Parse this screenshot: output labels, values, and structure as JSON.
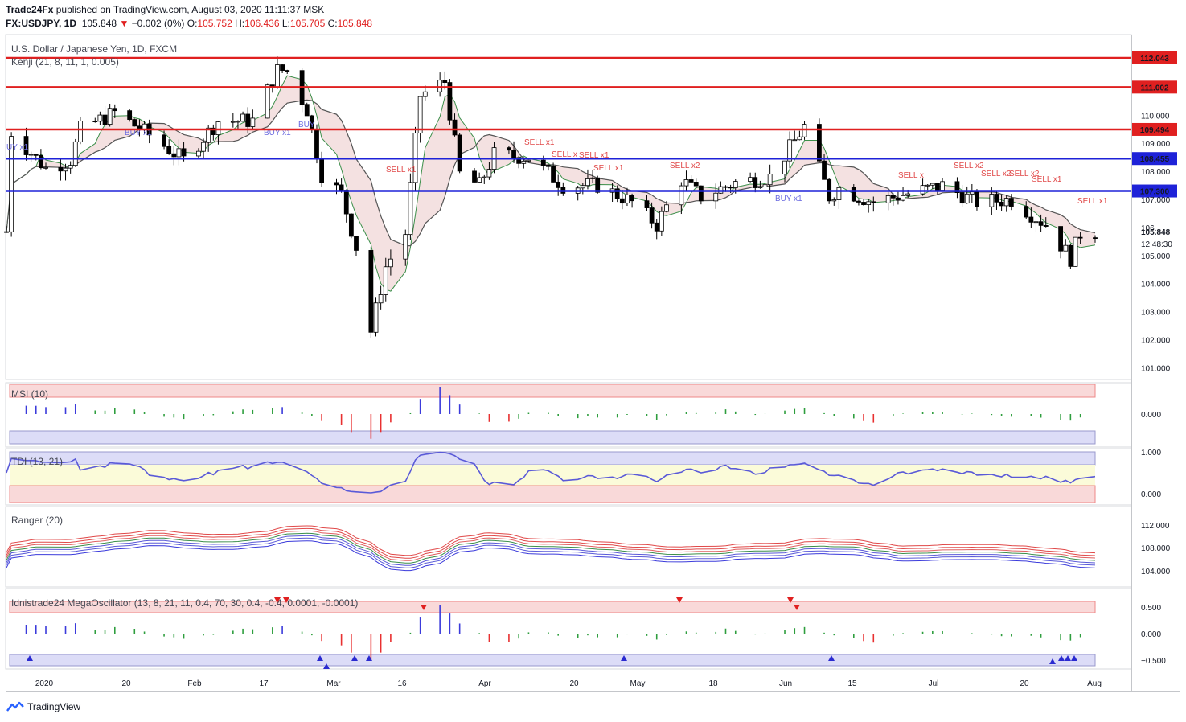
{
  "header": {
    "publisher": "Trade24Fx",
    "published_text": "published on TradingView.com, August 03, 2020 11:11:37 MSK",
    "symbol": "FX:USDJPY, 1D",
    "last": "105.848",
    "change_arrow": "▼",
    "change": "−0.002 (0%)",
    "o_label": "O:",
    "o_value": "105.752",
    "h_label": "H:",
    "h_value": "106.436",
    "l_label": "L:",
    "l_value": "105.705",
    "c_label": "C:",
    "c_value": "105.848"
  },
  "main_pane": {
    "title": "U.S. Dollar / Japanese Yen, 1D, FXCM",
    "indicator": "Kenji (21, 8, 11, 1, 0.005)",
    "price_ticks": [
      "110.000",
      "109.000",
      "108.000",
      "107.000",
      "105.000",
      "104.000",
      "103.000",
      "102.000",
      "101.000"
    ],
    "partial_tick": "106.",
    "horizontal_levels": [
      {
        "price": 112.043,
        "label": "112.043",
        "color": "#e02020"
      },
      {
        "price": 111.002,
        "label": "111.002",
        "color": "#e02020"
      },
      {
        "price": 109.494,
        "label": "109.494",
        "color": "#e02020"
      },
      {
        "price": 108.455,
        "label": "108.455",
        "color": "#1e22d8"
      },
      {
        "price": 107.3,
        "label": "107.300",
        "color": "#1e22d8"
      }
    ],
    "last_price_label": "105.848",
    "countdown": "12:48:30",
    "signals": [
      {
        "text": "UY x1",
        "type": "buy"
      },
      {
        "text": "BUY x1",
        "type": "buy"
      },
      {
        "text": "BUY x1",
        "type": "buy"
      },
      {
        "text": "BUY",
        "type": "buy"
      },
      {
        "text": "SELL x1",
        "type": "sell"
      },
      {
        "text": "SELL x1",
        "type": "sell"
      },
      {
        "text": "SELL x",
        "type": "sell"
      },
      {
        "text": "SELL x1",
        "type": "sell"
      },
      {
        "text": "SELL x1",
        "type": "sell"
      },
      {
        "text": "SELL x2",
        "type": "sell"
      },
      {
        "text": "BUY x1",
        "type": "buy"
      },
      {
        "text": "SELL x",
        "type": "sell"
      },
      {
        "text": "SELL x2",
        "type": "sell"
      },
      {
        "text": "SELL x2",
        "type": "sell"
      },
      {
        "text": "SELL x2",
        "type": "sell"
      },
      {
        "text": "SELL x1",
        "type": "sell"
      },
      {
        "text": "SELL x1",
        "type": "sell"
      }
    ]
  },
  "panes": {
    "msi": {
      "title": "MSI (10)",
      "ticks": [
        "0.000"
      ]
    },
    "tdi": {
      "title": "TDI (13, 21)",
      "ticks": [
        "1.000",
        "0.000"
      ]
    },
    "ranger": {
      "title": "Ranger (20)",
      "ticks": [
        "112.000",
        "108.000",
        "104.000"
      ]
    },
    "osc": {
      "title": "Idnistrade24 MegaOscillator (13, 8, 21, 11, 0.4, 70, 30, 0.4, -0.4, 0.0001, -0.0001)",
      "ticks": [
        "0.500",
        "0.000",
        "−0.500"
      ]
    }
  },
  "x_axis": {
    "labels": [
      "2020",
      "20",
      "Feb",
      "17",
      "Mar",
      "16",
      "Apr",
      "20",
      "May",
      "18",
      "Jun",
      "15",
      "Jul",
      "20",
      "Aug"
    ]
  },
  "footer": {
    "brand": "TradingView"
  },
  "colors": {
    "bull": "#ffffff",
    "bear": "#000000",
    "red_level": "#e02020",
    "blue_level": "#1e22d8",
    "up_hist": "#3b3bdb",
    "down_hist": "#e83030",
    "neutral_hist": "#2e9e3e"
  },
  "chart_data": [
    {
      "type": "candlestick",
      "title": "U.S. Dollar / Japanese Yen, 1D, FXCM",
      "x_range": [
        "2019-12-26",
        "2020-08-03"
      ],
      "ylim": [
        100.5,
        113.0
      ],
      "close_path": [
        [
          "2019-12-27",
          109.4
        ],
        [
          "2020-01-03",
          108.1
        ],
        [
          "2020-01-08",
          108.4
        ],
        [
          "2020-01-10",
          109.5
        ],
        [
          "2020-01-17",
          110.1
        ],
        [
          "2020-01-24",
          109.3
        ],
        [
          "2020-01-31",
          108.4
        ],
        [
          "2020-02-07",
          109.8
        ],
        [
          "2020-02-14",
          109.8
        ],
        [
          "2020-02-19",
          111.6
        ],
        [
          "2020-02-21",
          111.6
        ],
        [
          "2020-02-25",
          110.2
        ],
        [
          "2020-02-28",
          107.9
        ],
        [
          "2020-03-03",
          107.2
        ],
        [
          "2020-03-06",
          105.3
        ],
        [
          "2020-03-09",
          102.3
        ],
        [
          "2020-03-12",
          104.6
        ],
        [
          "2020-03-16",
          105.8
        ],
        [
          "2020-03-19",
          110.7
        ],
        [
          "2020-03-24",
          111.2
        ],
        [
          "2020-03-27",
          107.9
        ],
        [
          "2020-03-31",
          107.5
        ],
        [
          "2020-04-03",
          108.6
        ],
        [
          "2020-04-10",
          108.5
        ],
        [
          "2020-04-17",
          107.5
        ],
        [
          "2020-04-24",
          107.5
        ],
        [
          "2020-05-01",
          106.9
        ],
        [
          "2020-05-06",
          106.1
        ],
        [
          "2020-05-11",
          107.7
        ],
        [
          "2020-05-15",
          107.1
        ],
        [
          "2020-05-22",
          107.6
        ],
        [
          "2020-05-29",
          107.8
        ],
        [
          "2020-06-05",
          109.6
        ],
        [
          "2020-06-10",
          107.1
        ],
        [
          "2020-06-12",
          107.4
        ],
        [
          "2020-06-19",
          106.9
        ],
        [
          "2020-06-26",
          107.2
        ],
        [
          "2020-07-03",
          107.5
        ],
        [
          "2020-07-10",
          106.9
        ],
        [
          "2020-07-17",
          107.0
        ],
        [
          "2020-07-24",
          106.1
        ],
        [
          "2020-07-29",
          104.9
        ],
        [
          "2020-07-31",
          105.8
        ],
        [
          "2020-08-03",
          105.85
        ]
      ]
    },
    {
      "type": "bar",
      "title": "MSI (10)",
      "ylim": [
        -1,
        1
      ]
    },
    {
      "type": "line",
      "title": "TDI (13, 21)",
      "ylim": [
        -0.1,
        1.05
      ]
    },
    {
      "type": "line",
      "title": "Ranger (20)",
      "ylim": [
        102,
        115
      ]
    },
    {
      "type": "bar",
      "title": "Idnistrade24 MegaOscillator (13, 8, 21, 11, 0.4, 70, 30, 0.4, -0.4, 0.0001, -0.0001)",
      "ylim": [
        -0.65,
        0.65
      ]
    }
  ]
}
